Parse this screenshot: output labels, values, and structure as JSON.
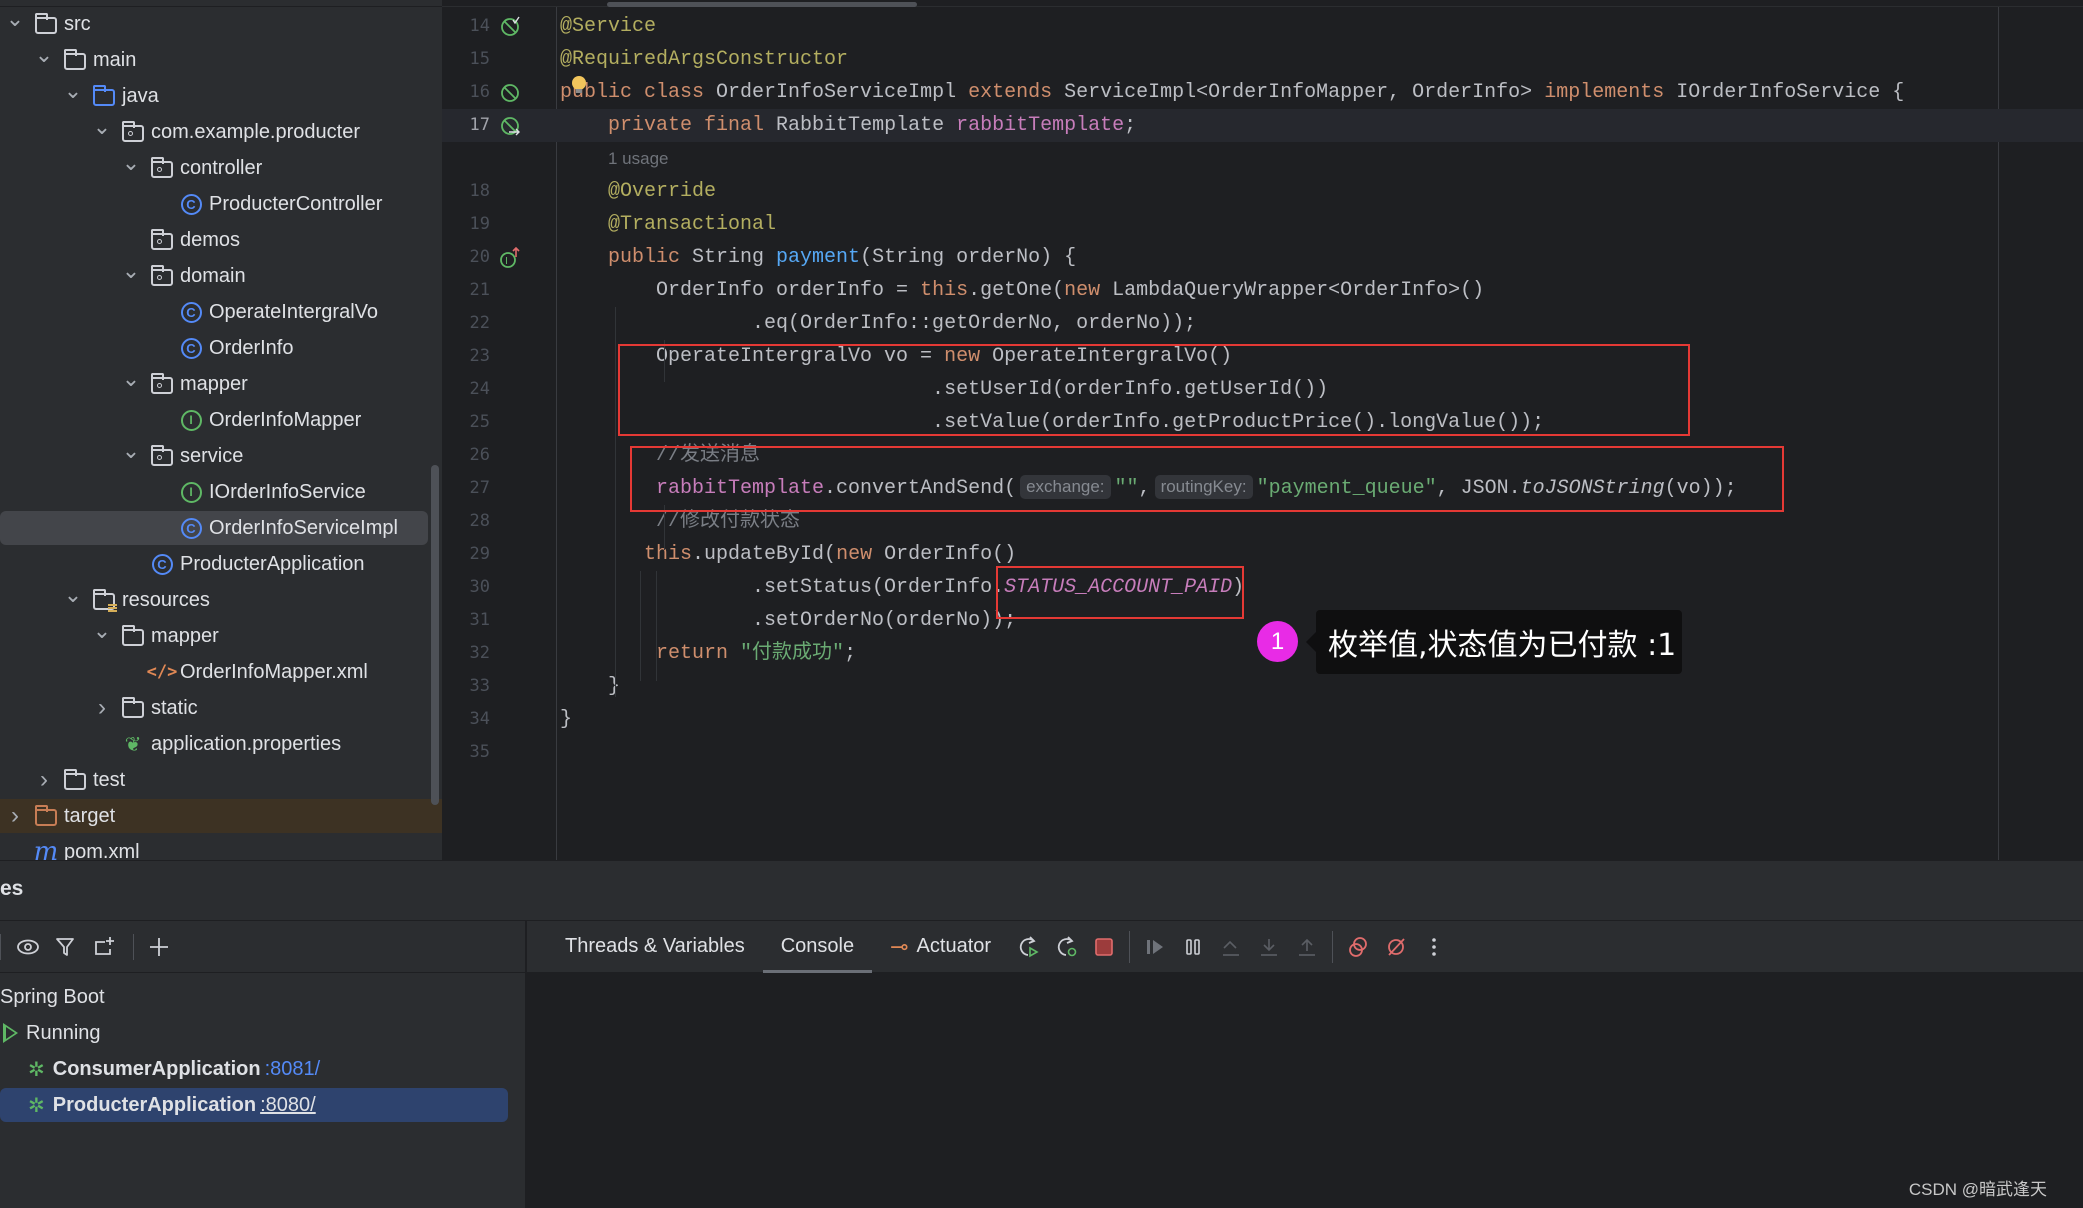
{
  "project_tree": {
    "items": [
      {
        "label": "src",
        "depth": 0,
        "icon": "folder-icon",
        "expanded": true
      },
      {
        "label": "main",
        "depth": 1,
        "icon": "folder-icon",
        "expanded": true
      },
      {
        "label": "java",
        "depth": 2,
        "icon": "source-folder-icon",
        "expanded": true
      },
      {
        "label": "com.example.producter",
        "depth": 3,
        "icon": "package-icon",
        "expanded": true
      },
      {
        "label": "controller",
        "depth": 4,
        "icon": "package-icon",
        "expanded": true
      },
      {
        "label": "ProducterController",
        "depth": 5,
        "icon": "class-icon"
      },
      {
        "label": "demos",
        "depth": 4,
        "icon": "package-icon"
      },
      {
        "label": "domain",
        "depth": 4,
        "icon": "package-icon",
        "expanded": true
      },
      {
        "label": "OperateIntergralVo",
        "depth": 5,
        "icon": "class-icon"
      },
      {
        "label": "OrderInfo",
        "depth": 5,
        "icon": "class-icon"
      },
      {
        "label": "mapper",
        "depth": 4,
        "icon": "package-icon",
        "expanded": true
      },
      {
        "label": "OrderInfoMapper",
        "depth": 5,
        "icon": "interface-icon"
      },
      {
        "label": "service",
        "depth": 4,
        "icon": "package-icon",
        "expanded": true
      },
      {
        "label": "IOrderInfoService",
        "depth": 5,
        "icon": "interface-icon"
      },
      {
        "label": "OrderInfoServiceImpl",
        "depth": 5,
        "icon": "class-icon",
        "selected": true
      },
      {
        "label": "ProducterApplication",
        "depth": 4,
        "icon": "spring-boot-class-icon"
      },
      {
        "label": "resources",
        "depth": 2,
        "icon": "resources-folder-icon",
        "expanded": true
      },
      {
        "label": "mapper",
        "depth": 3,
        "icon": "folder-icon",
        "expanded": true
      },
      {
        "label": "OrderInfoMapper.xml",
        "depth": 4,
        "icon": "xml-file-icon"
      },
      {
        "label": "static",
        "depth": 3,
        "icon": "folder-icon",
        "expanded": false
      },
      {
        "label": "application.properties",
        "depth": 3,
        "icon": "spring-properties-icon"
      },
      {
        "label": "test",
        "depth": 1,
        "icon": "folder-icon",
        "expanded": false
      },
      {
        "label": "target",
        "depth": 0,
        "icon": "excluded-folder-icon",
        "expanded": false
      },
      {
        "label": "pom.xml",
        "depth": 0,
        "icon": "maven-icon"
      }
    ]
  },
  "editor": {
    "lines": [
      {
        "num": "14",
        "html": "<span class='ann'>@Service</span>"
      },
      {
        "num": "15",
        "html": "<span class='ann'>@RequiredArgsConstructor</span>"
      },
      {
        "num": "16",
        "html": "<span class='kw'>public class</span> OrderInfoServiceImpl <span class='kw'>extends</span> ServiceImpl&lt;OrderInfoMapper, OrderInfo&gt; <span class='kw'>implements</span> IOrderInfoService {"
      },
      {
        "num": "17",
        "html": "    <span class='kw'>private final</span> RabbitTemplate <span class='fld'>rabbitTemplate</span>;",
        "current": true
      },
      {
        "num": "",
        "usage": "1 usage"
      },
      {
        "num": "18",
        "html": "    <span class='ann'>@Override</span>"
      },
      {
        "num": "19",
        "html": "    <span class='ann'>@Transactional</span>"
      },
      {
        "num": "20",
        "html": "    <span class='kw'>public</span> String <span class='fn'>payment</span>(String orderNo) {"
      },
      {
        "num": "21",
        "html": "        OrderInfo orderInfo = <span class='kw'>this</span>.getOne(<span class='kw'>new</span> LambdaQueryWrapper&lt;OrderInfo&gt;()"
      },
      {
        "num": "22",
        "html": "                .eq(OrderInfo::getOrderNo, orderNo));"
      },
      {
        "num": "23",
        "html": "        OperateIntergralVo vo = <span class='kw'>new</span> OperateIntergralVo()"
      },
      {
        "num": "24",
        "html": "                               .setUserId(orderInfo.getUserId())"
      },
      {
        "num": "25",
        "html": "                               .setValue(orderInfo.getProductPrice().longValue());"
      },
      {
        "num": "26",
        "html": "        <span class='cmt'>//发送消息</span>"
      },
      {
        "num": "27",
        "html": "        <span class='fld'>rabbitTemplate</span>.convertAndSend(<span class='hint'>exchange:</span><span class='str'>\"\"</span>,<span class='hint'>routingKey:</span><span class='str'>\"payment_queue\"</span>, JSON.<span class='it'>toJSONString</span>(vo));"
      },
      {
        "num": "28",
        "html": "        <span class='cmt'>//修改付款状态</span>"
      },
      {
        "num": "29",
        "html": "       <span class='kw'>this</span>.updateById(<span class='kw'>new</span> OrderInfo()"
      },
      {
        "num": "30",
        "html": "                .setStatus(OrderInfo.<span class='const'>STATUS_ACCOUNT_PAID</span>)"
      },
      {
        "num": "31",
        "html": "                .setOrderNo(orderNo));"
      },
      {
        "num": "32",
        "html": "        <span class='kw'>return</span> <span class='str'>\"付款成功\"</span>;"
      },
      {
        "num": "33",
        "html": "    }"
      },
      {
        "num": "34",
        "html": "}"
      },
      {
        "num": "35",
        "html": ""
      }
    ],
    "callout": {
      "badge": "1",
      "text": "枚举值,状态值为已付款 :1"
    }
  },
  "bottom_panel": {
    "title": "es",
    "services": {
      "tree": {
        "root": "Spring Boot",
        "group": "Running",
        "apps": [
          {
            "name": "ConsumerApplication",
            "port": ":8081/"
          },
          {
            "name": "ProducterApplication",
            "port": ":8080/",
            "selected": true
          }
        ]
      }
    },
    "tabs": [
      {
        "label": "Threads & Variables"
      },
      {
        "label": "Console",
        "active": true
      },
      {
        "label": "Actuator"
      }
    ]
  },
  "watermark": "CSDN @暗武逢天"
}
